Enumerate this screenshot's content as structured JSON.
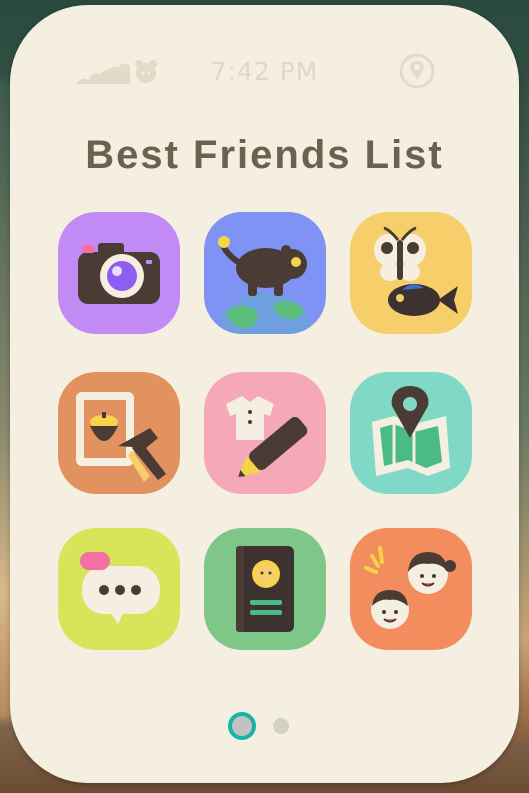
{
  "status_bar": {
    "time": "7:42 PM",
    "signal_icon": "waves-and-tanuki-icon",
    "location_icon": "map-pin-icon"
  },
  "title": "Best Friends List",
  "apps": [
    {
      "name": "camera-app",
      "icon": "camera-icon",
      "color": "#c28af5"
    },
    {
      "name": "island-app",
      "icon": "tanuki-earth-icon",
      "color": "#7f93f5"
    },
    {
      "name": "critterpedia-app",
      "icon": "butterfly-fish-icon",
      "color": "#f6cf6a"
    },
    {
      "name": "diy-recipes-app",
      "icon": "acorn-hammer-icon",
      "color": "#e1925e"
    },
    {
      "name": "custom-designs-app",
      "icon": "shirt-pencil-icon",
      "color": "#f5a8b8"
    },
    {
      "name": "map-app",
      "icon": "map-pin-icon",
      "color": "#7fd9c6"
    },
    {
      "name": "chat-log-app",
      "icon": "speech-bubble-icon",
      "color": "#d8e45a"
    },
    {
      "name": "passport-app",
      "icon": "passport-icon",
      "color": "#7fc689"
    },
    {
      "name": "best-friends-app",
      "icon": "two-friends-icon",
      "color": "#f48d5e"
    }
  ],
  "pagination": {
    "pages": 2,
    "current": 1,
    "active_color": "#19b3a3"
  }
}
